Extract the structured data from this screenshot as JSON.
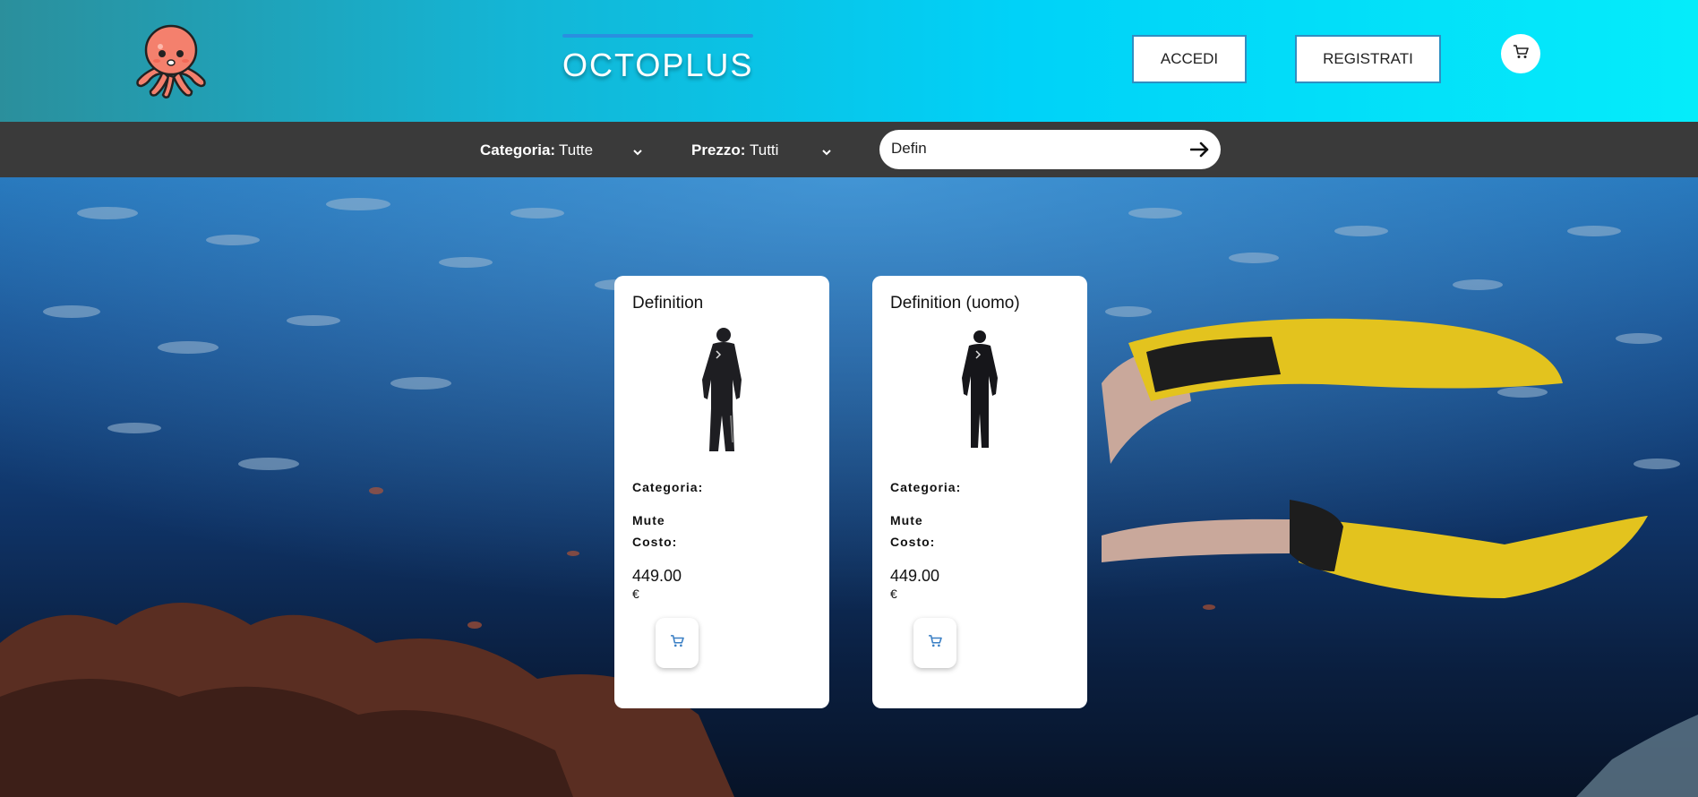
{
  "header": {
    "brand": "OCTOPLUS",
    "login_label": "ACCEDI",
    "register_label": "REGISTRATI",
    "accent_color": "#00d2f8"
  },
  "filters": {
    "category_label": "Categoria:",
    "category_value": "Tutte",
    "price_label": "Prezzo:",
    "price_value": "Tutti",
    "search_value": "Defin"
  },
  "products": [
    {
      "name": "Definition",
      "category_label": "Categoria:",
      "category": "Mute",
      "cost_label": "Costo:",
      "price": "449.00",
      "currency": "€",
      "cart_icon": "cart-icon"
    },
    {
      "name": "Definition (uomo)",
      "category_label": "Categoria:",
      "category": "Mute",
      "cost_label": "Costo:",
      "price": "449.00",
      "currency": "€",
      "cart_icon": "cart-icon"
    }
  ]
}
